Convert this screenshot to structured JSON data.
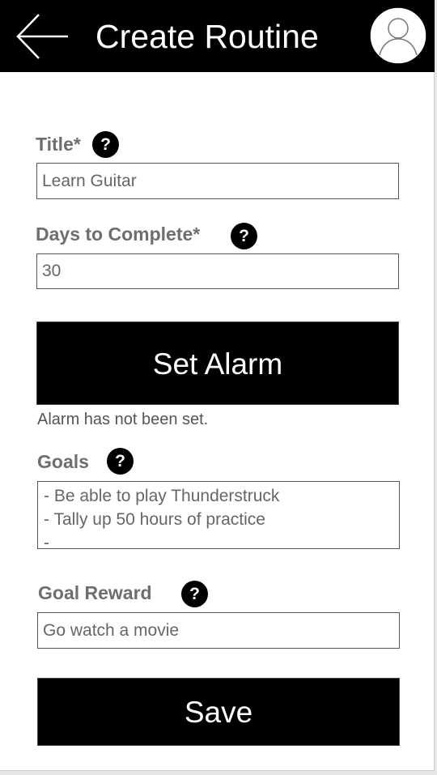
{
  "header": {
    "title": "Create Routine"
  },
  "form": {
    "title_label": "Title*",
    "title_value": "Learn Guitar",
    "days_label": "Days to Complete*",
    "days_value": "30",
    "alarm_button": "Set Alarm",
    "alarm_status": "Alarm has not been set.",
    "goals_label": "Goals",
    "goals_lines": [
      "- Be able to play Thunderstruck",
      "- Tally up 50 hours of practice",
      "-"
    ],
    "reward_label": "Goal Reward",
    "reward_value": "Go watch a movie",
    "save_button": "Save",
    "help_glyph": "?"
  },
  "icons": {
    "back": "arrow-left-icon",
    "profile": "user-avatar-icon",
    "help": "question-circle-icon"
  },
  "colors": {
    "header_bg": "#000000",
    "button_bg": "#000000",
    "label_text": "#6e6e6e"
  }
}
